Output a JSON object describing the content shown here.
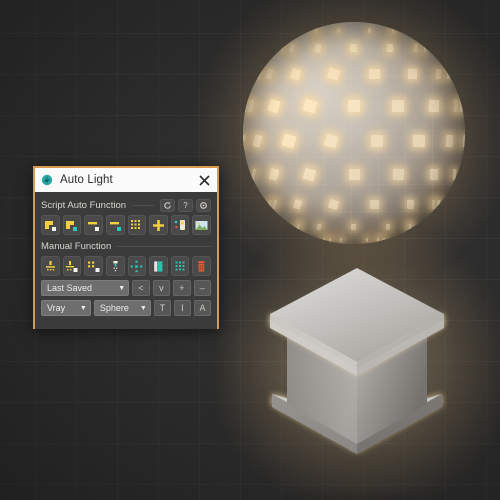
{
  "scene": {
    "background_color": "#2e2e2e",
    "grid_color": "#3a3a3a",
    "objects": [
      {
        "name": "faceted-light-sphere",
        "emissive_color": "#ffe9c2",
        "body_color": "#c9c4bc"
      },
      {
        "name": "isometric-light-pedestal",
        "emissive_color": "#ffe9c2",
        "body_color": "#b9b6b1"
      }
    ]
  },
  "panel": {
    "title": "Auto Light",
    "title_icon": "app-logo-icon",
    "close_label": "✕",
    "accent_color": "#d99a4e",
    "sections": [
      {
        "label": "Script Auto Function",
        "mini_buttons": [
          {
            "name": "refresh-button",
            "glyph": "↻"
          },
          {
            "name": "help-button",
            "glyph": "?"
          },
          {
            "name": "settings-button",
            "glyph": "⚙"
          }
        ],
        "icons": [
          {
            "name": "create-light-corner-icon",
            "title": "Create Light"
          },
          {
            "name": "create-light-corner-alt-icon",
            "title": "Create Light Alt"
          },
          {
            "name": "light-plane-icon",
            "title": "Light Plane"
          },
          {
            "name": "light-plane-alt-icon",
            "title": "Light Plane Alt"
          },
          {
            "name": "light-array-grid-icon",
            "title": "Light Array"
          },
          {
            "name": "add-light-plus-icon",
            "title": "Add Light"
          },
          {
            "name": "light-probe-icon",
            "title": "Light Probe"
          },
          {
            "name": "render-preview-icon",
            "title": "Render Preview"
          }
        ]
      },
      {
        "label": "Manual Function",
        "mini_buttons": [],
        "icons": [
          {
            "name": "point-light-icon",
            "title": "Point Light"
          },
          {
            "name": "point-light-object-icon",
            "title": "Point Light Object"
          },
          {
            "name": "multi-light-object-icon",
            "title": "Multi Light Object"
          },
          {
            "name": "spot-light-icon",
            "title": "Spot Light"
          },
          {
            "name": "light-target-icon",
            "title": "Light Target"
          },
          {
            "name": "area-light-icon",
            "title": "Area Light"
          },
          {
            "name": "light-matrix-icon",
            "title": "Light Matrix"
          },
          {
            "name": "delete-light-icon",
            "title": "Delete Light"
          }
        ]
      }
    ],
    "preset_row": {
      "dropdown": {
        "name": "preset-dropdown",
        "value": "Last Saved",
        "caret": "▼"
      },
      "buttons": [
        {
          "name": "prev-preset-button",
          "label": "<"
        },
        {
          "name": "preset-menu-button",
          "label": "v"
        },
        {
          "name": "add-preset-button",
          "label": "+"
        },
        {
          "name": "remove-preset-button",
          "label": "–"
        }
      ]
    },
    "renderer_row": {
      "renderer_dropdown": {
        "name": "renderer-dropdown",
        "value": "Vray",
        "caret": "▼"
      },
      "shape_dropdown": {
        "name": "shape-dropdown",
        "value": "Sphere",
        "caret": "▼"
      },
      "buttons": [
        {
          "name": "target-toggle-button",
          "label": "T"
        },
        {
          "name": "instance-toggle-button",
          "label": "I"
        },
        {
          "name": "align-toggle-button",
          "label": "A"
        }
      ]
    }
  }
}
